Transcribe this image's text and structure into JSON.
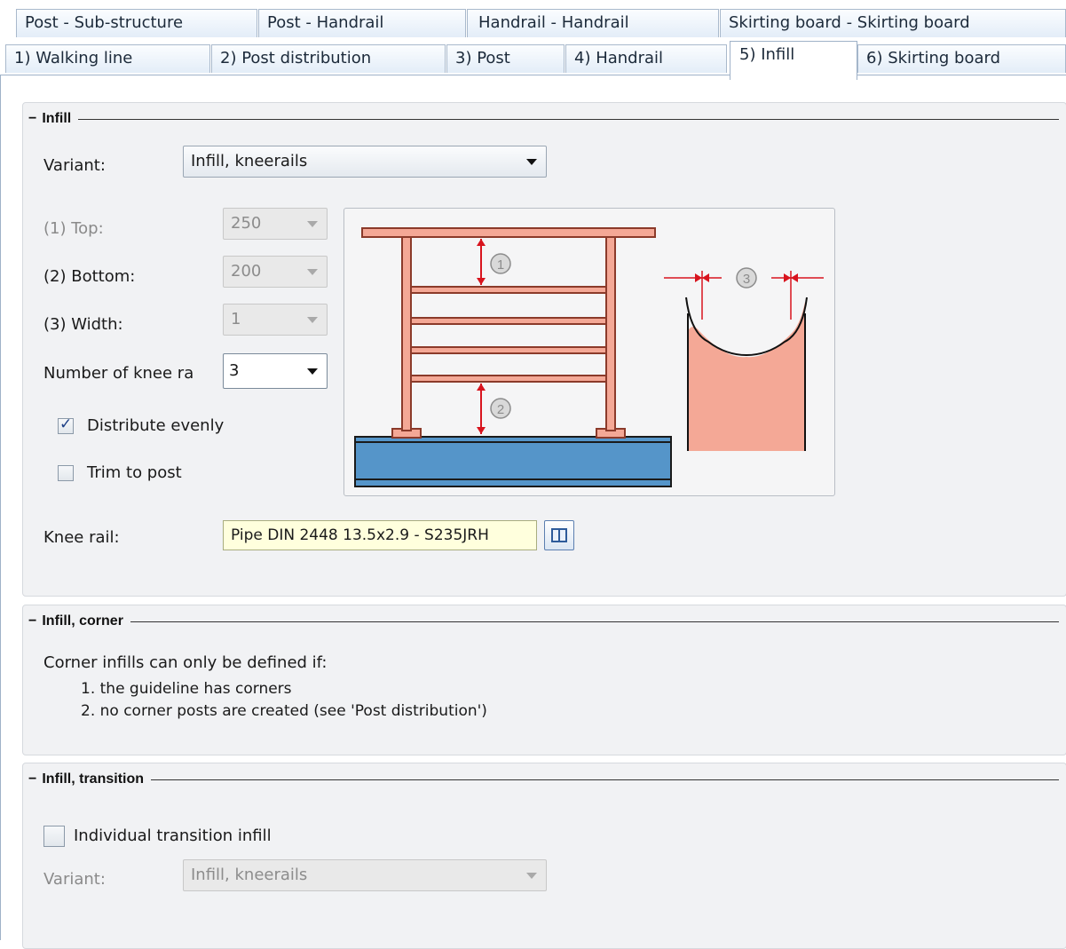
{
  "tabs": {
    "row1": [
      "Post - Sub-structure",
      "Post - Handrail",
      "Handrail - Handrail",
      "Skirting board - Skirting board"
    ],
    "row2": [
      "1) Walking line",
      "2) Post distribution",
      "3) Post",
      "4) Handrail",
      "5) Infill",
      "6) Skirting board"
    ],
    "active": "5) Infill"
  },
  "infill": {
    "title": "Infill",
    "variant_label": "Variant:",
    "variant_value": "Infill, kneerails",
    "top_label": "(1) Top:",
    "top_value": "250",
    "bottom_label": "(2) Bottom:",
    "bottom_value": "200",
    "width_label": "(3) Width:",
    "width_value": "1",
    "num_label": "Number of knee ra",
    "num_value": "3",
    "distribute_label": "Distribute evenly",
    "distribute_checked": true,
    "trim_label": "Trim to post",
    "trim_checked": false,
    "knee_rail_label": "Knee rail:",
    "knee_rail_value": "Pipe DIN 2448 13.5x2.9 - S235JRH",
    "marker_1": "1",
    "marker_2": "2",
    "marker_3": "3"
  },
  "corner": {
    "title": "Infill, corner",
    "text": "Corner infills can only be defined if:",
    "item1": "1. the guideline has corners",
    "item2": "2. no corner posts are created (see 'Post distribution')"
  },
  "transition": {
    "title": "Infill, transition",
    "individual_label": "Individual transition infill",
    "individual_checked": false,
    "variant_label": "Variant:",
    "variant_value": "Infill, kneerails"
  },
  "colors": {
    "rail_fill": "#f4a896",
    "rail_stroke": "#8b3a2a",
    "floor_fill": "#5595c9",
    "dimension": "#d8141e"
  }
}
